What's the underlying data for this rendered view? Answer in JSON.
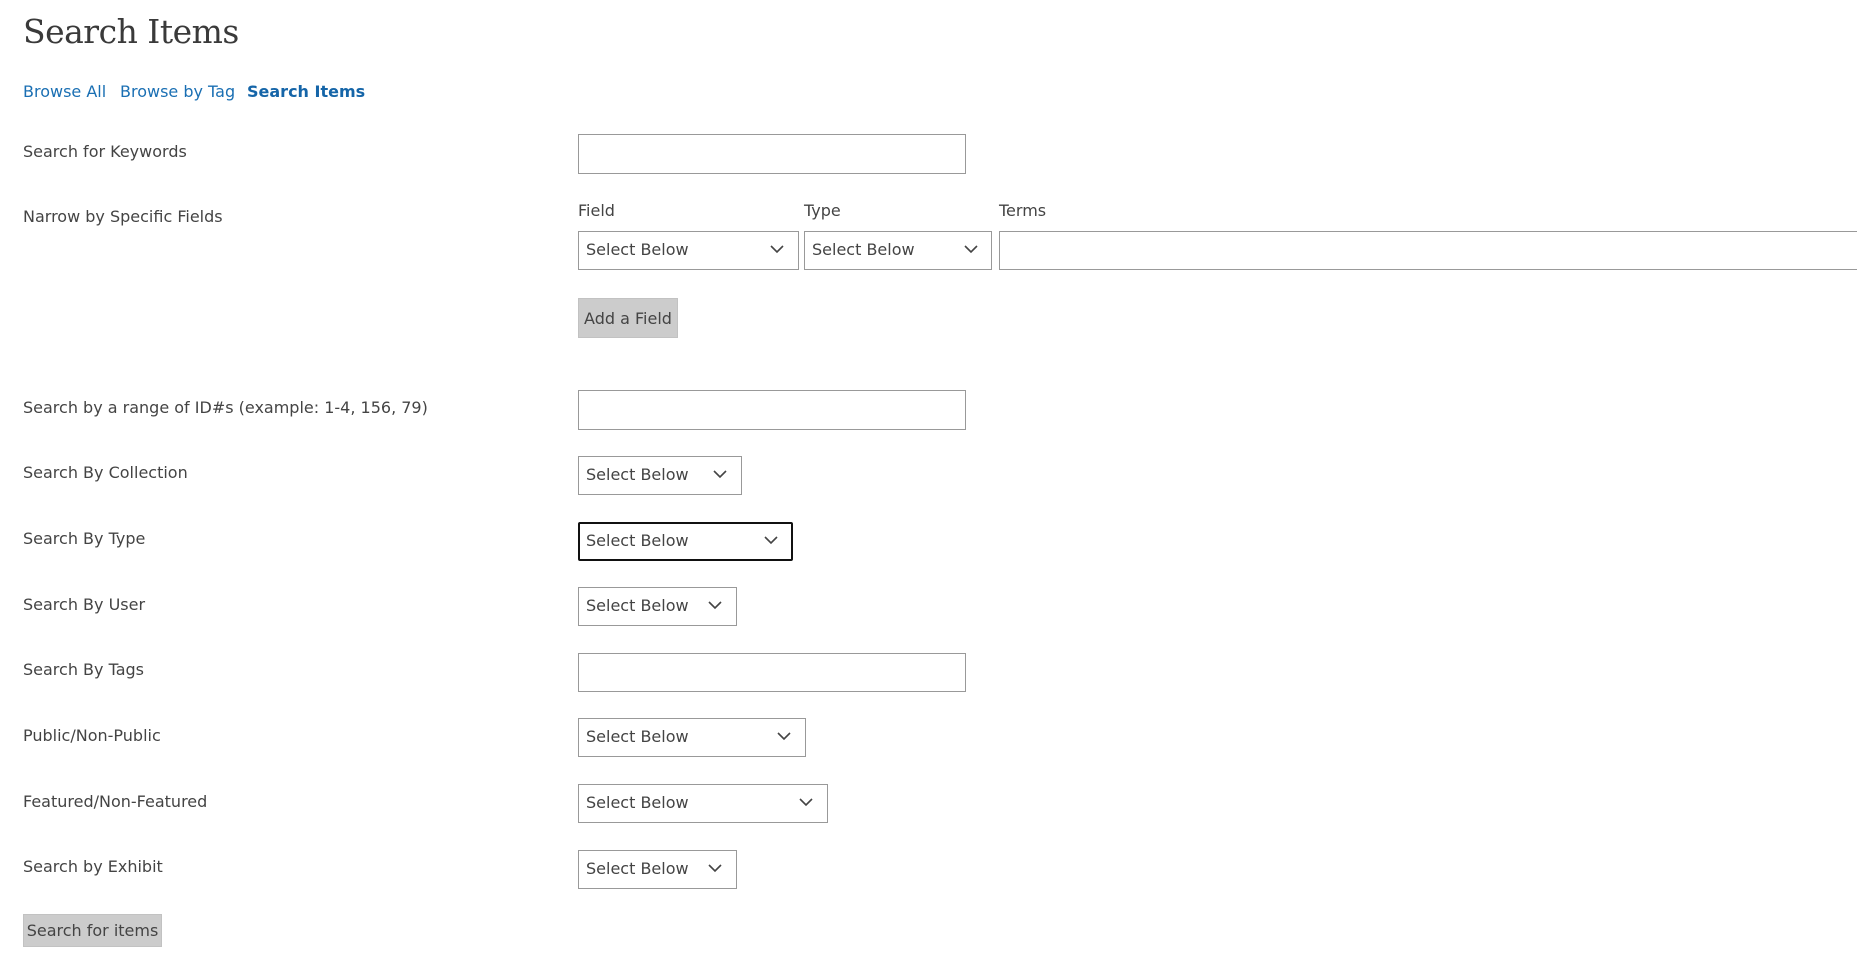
{
  "page": {
    "title": "Search Items"
  },
  "nav": [
    {
      "label": "Browse All"
    },
    {
      "label": "Browse by Tag"
    },
    {
      "label": "Search Items",
      "current": true
    }
  ],
  "form": {
    "keywords": {
      "label": "Search for Keywords",
      "value": ""
    },
    "narrow": {
      "label": "Narrow by Specific Fields",
      "headers": {
        "field": "Field",
        "type": "Type",
        "terms": "Terms"
      },
      "field_select": "Select Below",
      "type_select": "Select Below",
      "terms_value": "",
      "add_button": "Add a Field"
    },
    "range": {
      "label": "Search by a range of ID#s (example: 1-4, 156, 79)",
      "value": ""
    },
    "collection": {
      "label": "Search By Collection",
      "selected": "Select Below"
    },
    "type": {
      "label": "Search By Type",
      "selected": "Select Below"
    },
    "user": {
      "label": "Search By User",
      "selected": "Select Below"
    },
    "tags": {
      "label": "Search By Tags",
      "value": ""
    },
    "public": {
      "label": "Public/Non-Public",
      "selected": "Select Below"
    },
    "featured": {
      "label": "Featured/Non-Featured",
      "selected": "Select Below"
    },
    "exhibit": {
      "label": "Search by Exhibit",
      "selected": "Select Below"
    },
    "submit": "Search for items"
  },
  "icons": {
    "dropdown": "chevron-down-icon"
  }
}
